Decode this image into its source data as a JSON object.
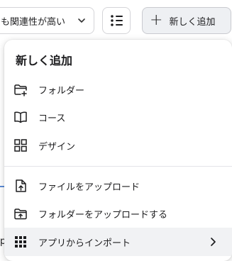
{
  "toolbar": {
    "sort_value": "も関連性が高い",
    "new_button_label": "新しく追加"
  },
  "background": {
    "fragment_text": "p"
  },
  "menu": {
    "title": "新しく追加",
    "create_items": [
      {
        "label": "フォルダー",
        "icon": "folder-add-icon"
      },
      {
        "label": "コース",
        "icon": "book-icon"
      },
      {
        "label": "デザイン",
        "icon": "grid-layout-icon"
      }
    ],
    "upload_items": [
      {
        "label": "ファイルをアップロード",
        "icon": "file-upload-icon"
      },
      {
        "label": "フォルダーをアップロードする",
        "icon": "folder-upload-icon"
      },
      {
        "label": "アプリからインポート",
        "icon": "apps-grid-icon"
      }
    ]
  }
}
